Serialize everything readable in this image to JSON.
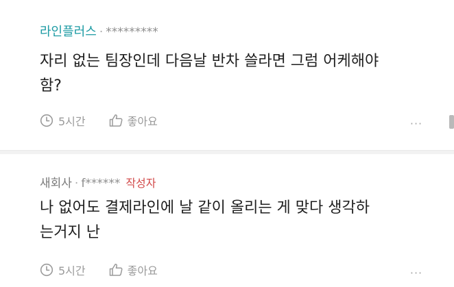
{
  "comments": [
    {
      "author": "라인플러스",
      "separator": "·",
      "masked_id": "*********",
      "text": "자리 없는 팀장인데 다음날 반차 쓸라면 그럼 어케해야\n함?",
      "time": "5시간",
      "like_label": "좋아요",
      "more_label": "···"
    },
    {
      "author": "새회사",
      "separator": "·",
      "masked_id": "f******",
      "badge": "작성자",
      "text": "나 없어도 결제라인에 날 같이 올리는 게 맞다 생각하\n는거지 난",
      "time": "5시간",
      "like_label": "좋아요",
      "more_label": "···"
    }
  ],
  "colors": {
    "author_primary": "#1b9aa3",
    "author_secondary": "#7a7a7a",
    "writer_badge": "#d24a4a",
    "meta_text": "#8d8d8d",
    "body_text": "#1e1e1e",
    "icon": "#9a9a9a",
    "separator_bg": "#f2f2f2"
  },
  "icons": {
    "time": "clock-icon",
    "like": "thumbs-up-icon",
    "more": "more-dots-icon"
  }
}
